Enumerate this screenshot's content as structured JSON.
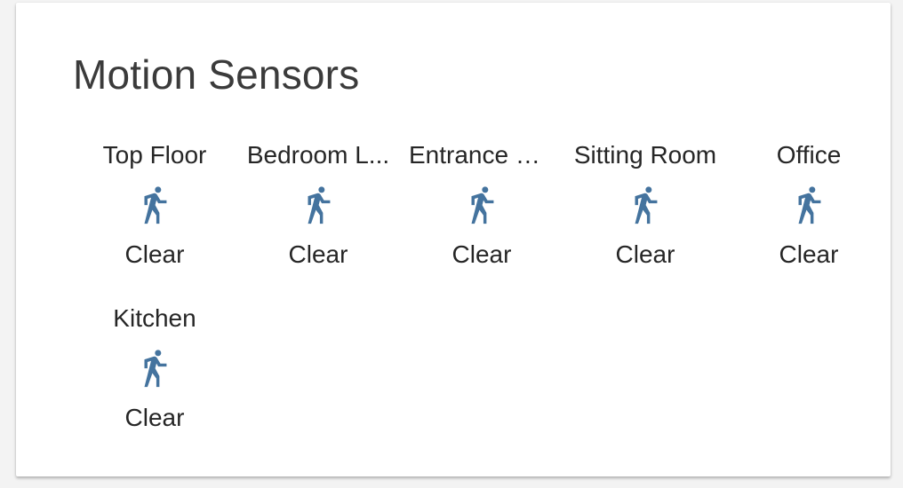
{
  "card": {
    "title": "Motion Sensors"
  },
  "colors": {
    "icon": "#44739e",
    "text": "#262626",
    "title": "#3b3b3b",
    "card_background": "#ffffff",
    "page_background": "#f3f3f3"
  },
  "icon_name": "walk-icon",
  "entities": [
    {
      "name": "Top Floor",
      "state": "Clear",
      "icon": "walk-icon"
    },
    {
      "name": "Bedroom L...",
      "state": "Clear",
      "icon": "walk-icon"
    },
    {
      "name": "Entrance Hall",
      "state": "Clear",
      "icon": "walk-icon"
    },
    {
      "name": "Sitting Room",
      "state": "Clear",
      "icon": "walk-icon"
    },
    {
      "name": "Office",
      "state": "Clear",
      "icon": "walk-icon"
    },
    {
      "name": "Kitchen",
      "state": "Clear",
      "icon": "walk-icon"
    }
  ]
}
